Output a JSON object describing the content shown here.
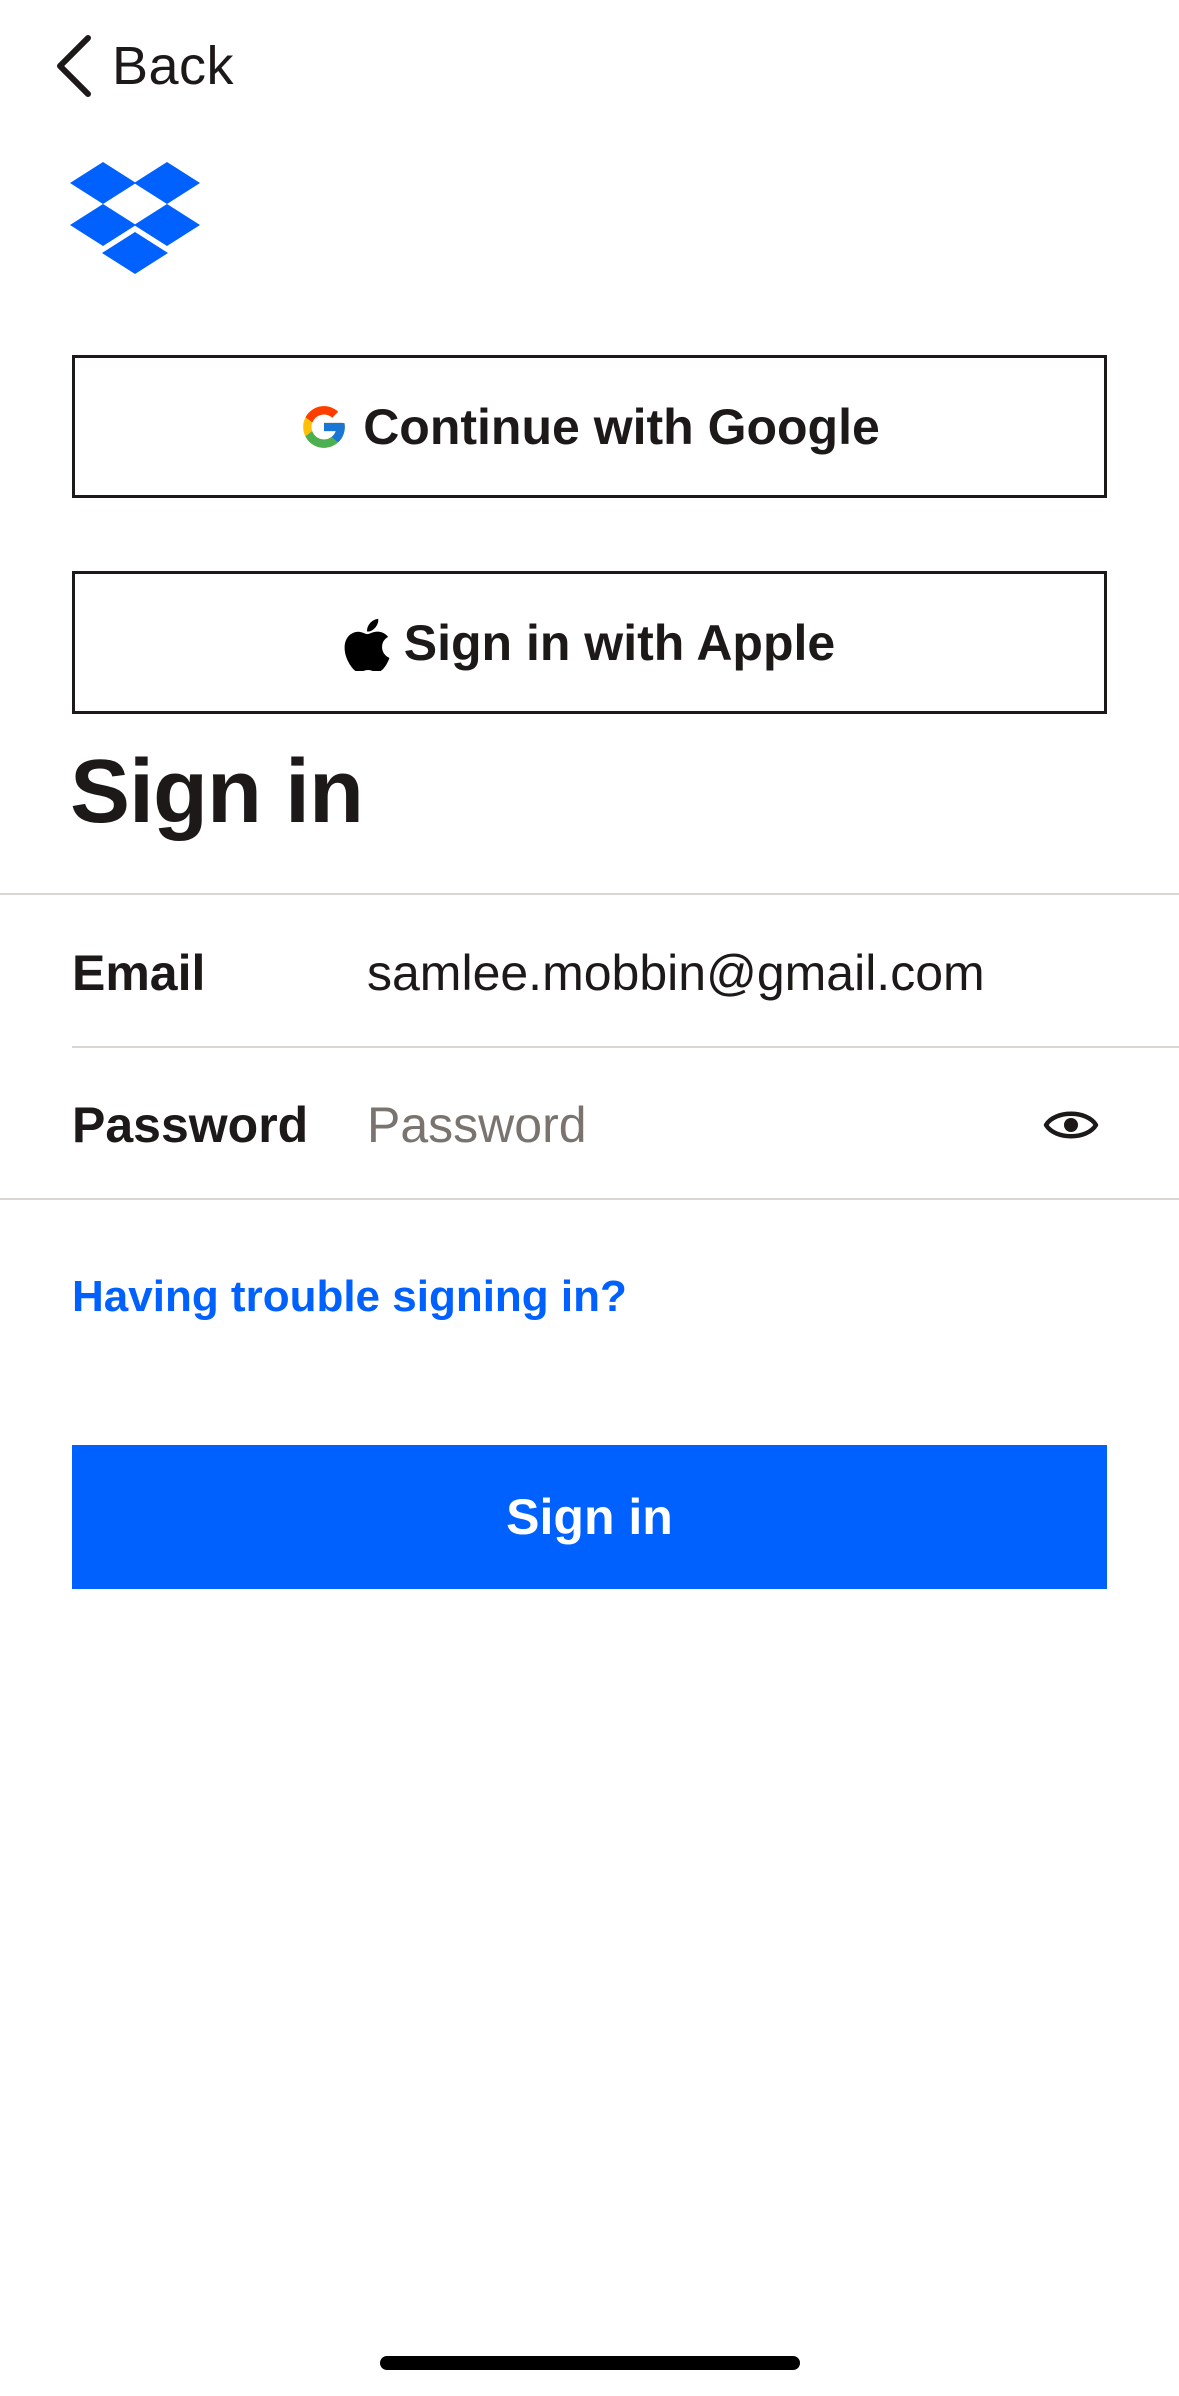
{
  "nav": {
    "back_label": "Back"
  },
  "brand": {
    "logo_icon": "dropbox-logo",
    "color": "#0061fe"
  },
  "sso": {
    "google_label": "Continue with Google",
    "google_icon": "google-g-icon",
    "apple_label": "Sign in with Apple",
    "apple_icon": "apple-icon"
  },
  "form": {
    "heading": "Sign in",
    "email_label": "Email",
    "email_value": "samlee.mobbin@gmail.com",
    "password_label": "Password",
    "password_placeholder": "Password",
    "password_value": "",
    "show_password_icon": "eye-icon",
    "trouble_link": "Having trouble signing in?",
    "submit_label": "Sign in"
  },
  "colors": {
    "accent": "#0061fe",
    "text": "#1e1919",
    "divider": "#d9d6d2"
  }
}
